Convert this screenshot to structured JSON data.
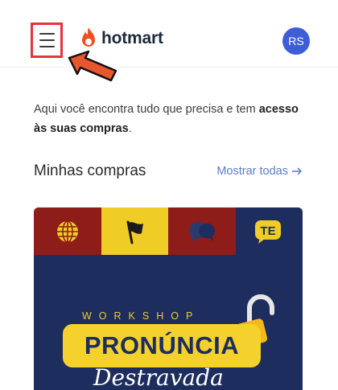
{
  "header": {
    "logo_text": "hotmart",
    "avatar_initials": "RS",
    "menu_icon": "hamburger-menu-icon",
    "colors": {
      "highlight": "#e5343b",
      "logo_flame": "#f04e23",
      "avatar_bg": "#3d5ed6"
    }
  },
  "intro": {
    "text_plain": "Aqui você encontra tudo que precisa e tem ",
    "text_bold": "acesso às suas compras",
    "text_end": "."
  },
  "purchases": {
    "title": "Minhas compras",
    "show_all_label": "Mostrar todas",
    "show_all_icon": "arrow-right-icon"
  },
  "course_card": {
    "tile_icons": [
      "globe-icon",
      "flag-icon",
      "speech-bubble-icon",
      "te-logo-icon"
    ],
    "tile_te_text": "TE",
    "workshop_label": "WORKSHOP",
    "headline": "PRONÚNCIA",
    "subline": "Destravada",
    "colors": {
      "navy": "#1c2d5e",
      "yellow": "#f0cc27",
      "red": "#8e1c18"
    }
  },
  "annotation": {
    "arrow_color": "#e8562f"
  }
}
